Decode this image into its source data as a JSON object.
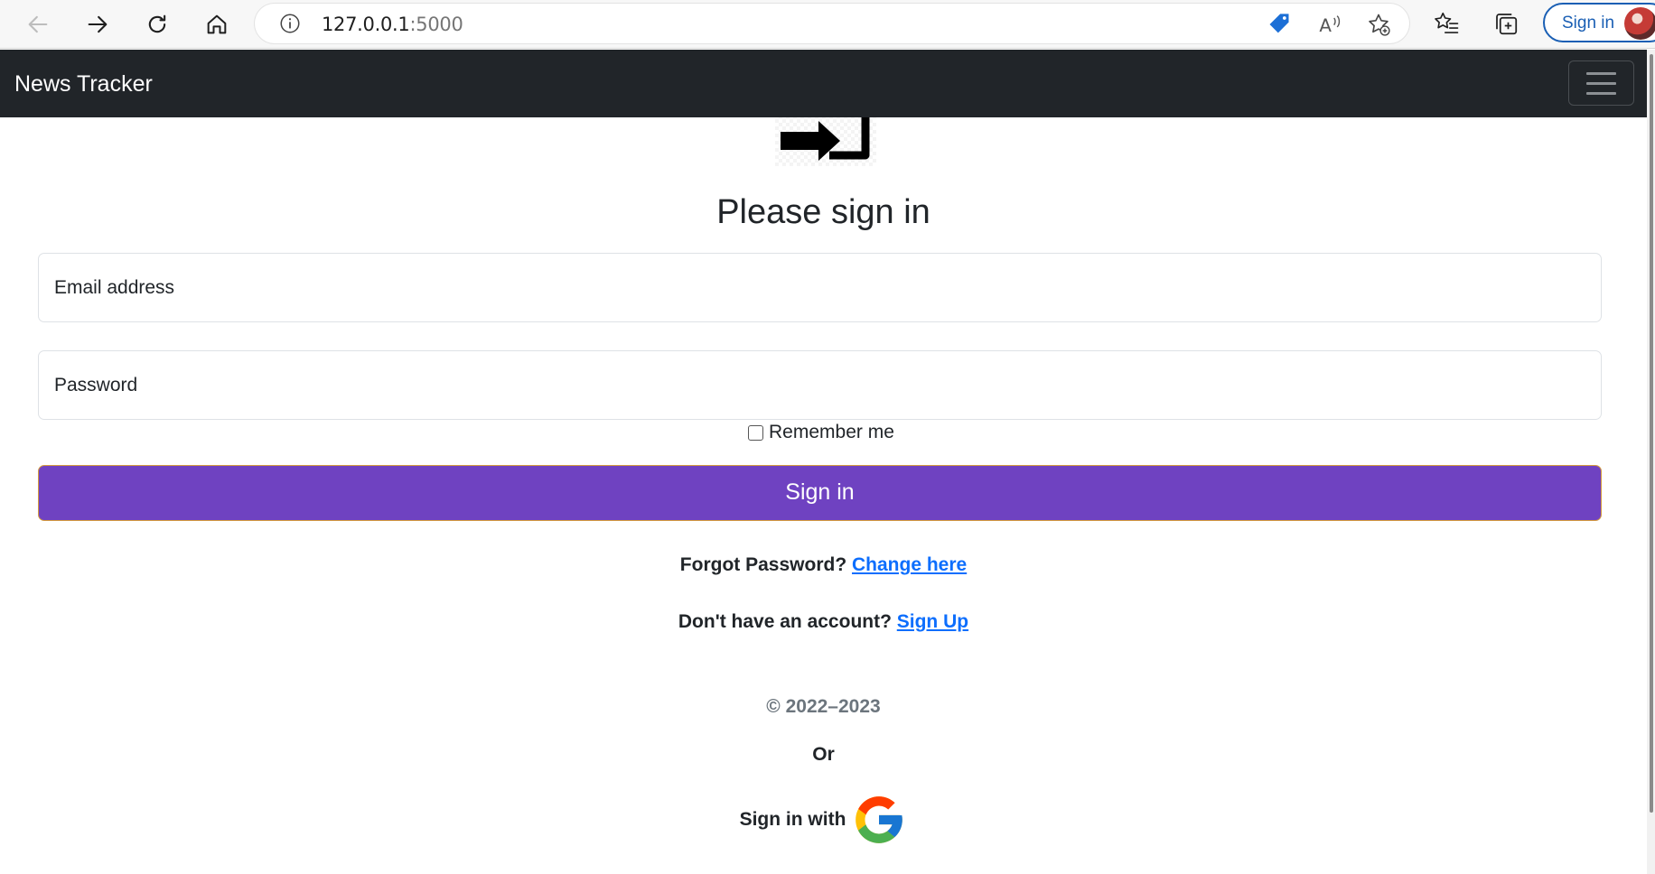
{
  "browser": {
    "url_host": "127.0.0.1",
    "url_port": ":5000",
    "signin_label": "Sign in"
  },
  "navbar": {
    "brand": "News Tracker"
  },
  "form": {
    "heading": "Please sign in",
    "email_label": "Email address",
    "password_label": "Password",
    "remember_label": "Remember me",
    "submit_label": "Sign in"
  },
  "links": {
    "forgot_text": "Forgot Password?",
    "forgot_link": "Change here",
    "signup_text": "Don't have an account?",
    "signup_link": "Sign Up"
  },
  "footer": {
    "copyright": "© 2022–2023",
    "or_text": "Or",
    "google_text": "Sign in with"
  },
  "colors": {
    "navbar_bg": "#212529",
    "primary_button": "#6f42c1",
    "link": "#0d6efd"
  },
  "icons": [
    "back-icon",
    "forward-icon",
    "refresh-icon",
    "home-icon",
    "info-icon",
    "price-tag-icon",
    "read-aloud-icon",
    "add-favorite-icon",
    "favorites-icon",
    "collections-icon",
    "login-icon",
    "google-icon"
  ]
}
